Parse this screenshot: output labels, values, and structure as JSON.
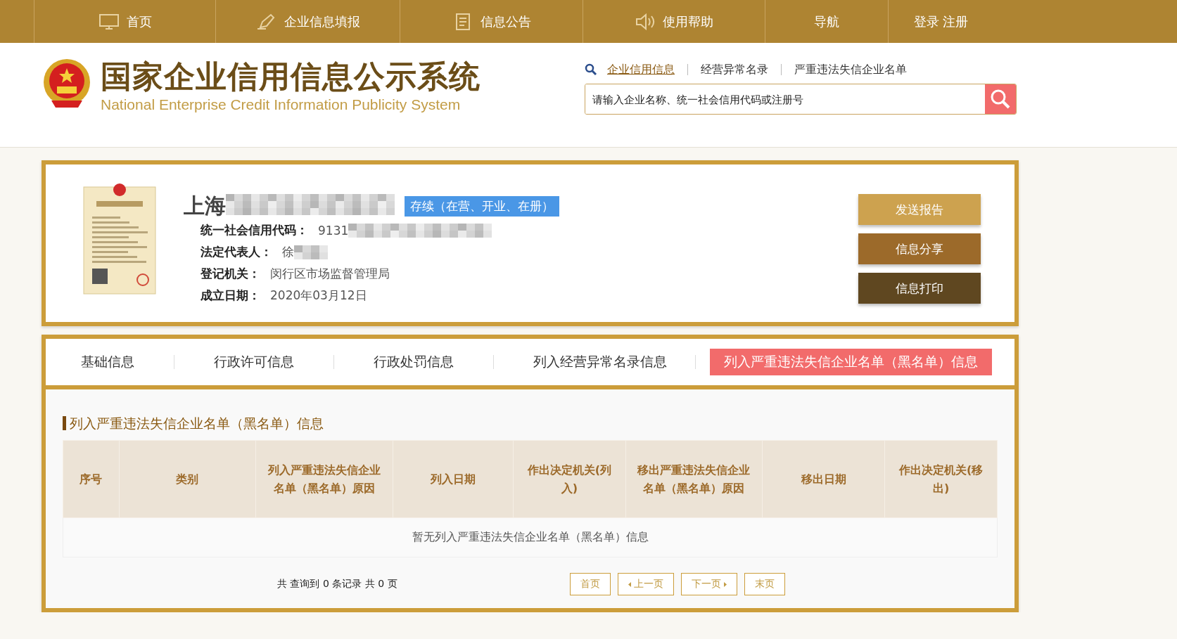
{
  "nav": [
    {
      "label": "首页"
    },
    {
      "label": "企业信息填报"
    },
    {
      "label": "信息公告"
    },
    {
      "label": "使用帮助"
    },
    {
      "label": "导航"
    },
    {
      "label": "登录  注册"
    }
  ],
  "site": {
    "title": "国家企业信用信息公示系统",
    "subtitle": "National Enterprise Credit Information Publicity System"
  },
  "search": {
    "tabs": [
      {
        "label": "企业信用信息",
        "selected": true
      },
      {
        "label": "经营异常名录",
        "selected": false
      },
      {
        "label": "严重违法失信企业名单",
        "selected": false
      }
    ],
    "placeholder": "请输入企业名称、统一社会信用代码或注册号"
  },
  "company": {
    "name": "上海",
    "status": "存续（在营、开业、在册）",
    "fields": [
      {
        "label": "统一社会信用代码：",
        "value": "9131",
        "redacted": true
      },
      {
        "label": "法定代表人：",
        "value": "徐",
        "redacted": true
      },
      {
        "label": "登记机关：",
        "value": "闵行区市场监督管理局",
        "redacted": false
      },
      {
        "label": "成立日期：",
        "value": "2020年03月12日",
        "redacted": false
      }
    ],
    "actions": [
      {
        "label": "发送报告",
        "color": "#cda24f"
      },
      {
        "label": "信息分享",
        "color": "#9c6a2a"
      },
      {
        "label": "信息打印",
        "color": "#5f4720"
      }
    ]
  },
  "tabs": [
    {
      "label": "基础信息",
      "selected": false
    },
    {
      "label": "行政许可信息",
      "selected": false
    },
    {
      "label": "行政处罚信息",
      "selected": false
    },
    {
      "label": "列入经营异常名录信息",
      "selected": false
    },
    {
      "label": "列入严重违法失信企业名单（黑名单）信息",
      "selected": true
    }
  ],
  "section": {
    "title": "列入严重违法失信企业名单（黑名单）信息",
    "table": {
      "columns": [
        "序号",
        "类别",
        "列入严重违法失信企业名单（黑名单）原因",
        "列入日期",
        "作出决定机关(列入)",
        "移出严重违法失信企业名单（黑名单）原因",
        "移出日期",
        "作出决定机关(移出)"
      ],
      "empty": "暂无列入严重违法失信企业名单（黑名单）信息"
    },
    "summary": "共 查询到 0 条记录 共 0 页",
    "pager": [
      {
        "label": "首页",
        "kind": "plain"
      },
      {
        "label": "上一页",
        "kind": "prev"
      },
      {
        "label": "下一页",
        "kind": "next"
      },
      {
        "label": "末页",
        "kind": "plain"
      }
    ]
  }
}
